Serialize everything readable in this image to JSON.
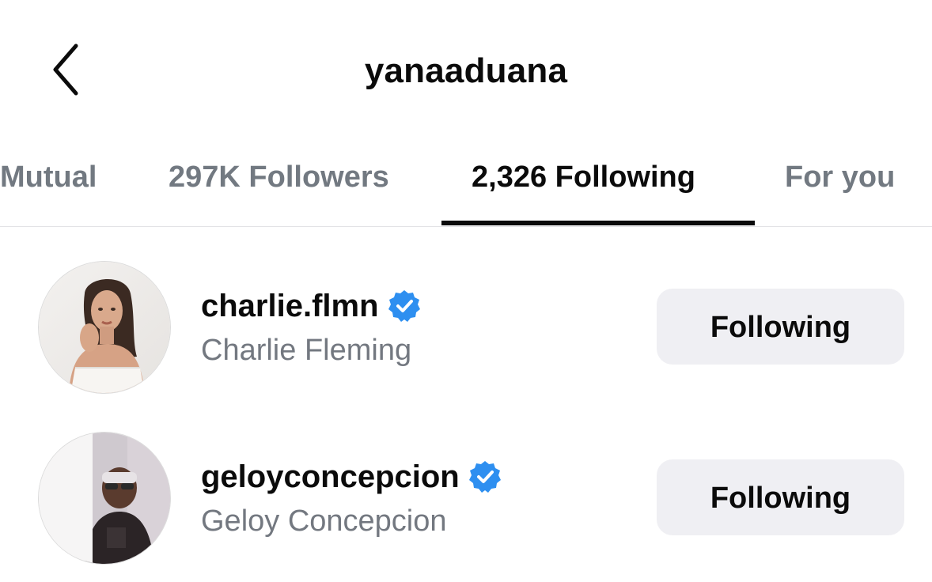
{
  "header": {
    "title": "yanaaduana",
    "back_icon": "chevron-left-icon"
  },
  "tabs": [
    {
      "label": "Mutual",
      "active": false
    },
    {
      "label": "297K Followers",
      "active": false
    },
    {
      "label": "2,326 Following",
      "active": true
    },
    {
      "label": "For you",
      "active": false
    }
  ],
  "list": [
    {
      "username": "charlie.flmn",
      "full_name": "Charlie Fleming",
      "verified": true,
      "button_label": "Following",
      "avatar_icon": "profile-photo"
    },
    {
      "username": "geloyconcepcion",
      "full_name": "Geloy Concepcion",
      "verified": true,
      "button_label": "Following",
      "avatar_icon": "profile-photo"
    }
  ],
  "colors": {
    "text_primary": "#0b0b0b",
    "text_secondary": "#737880",
    "tab_inactive": "#727981",
    "button_bg": "#efeff3",
    "verified_blue": "#2e8ff0",
    "divider": "#e3e3e6"
  }
}
